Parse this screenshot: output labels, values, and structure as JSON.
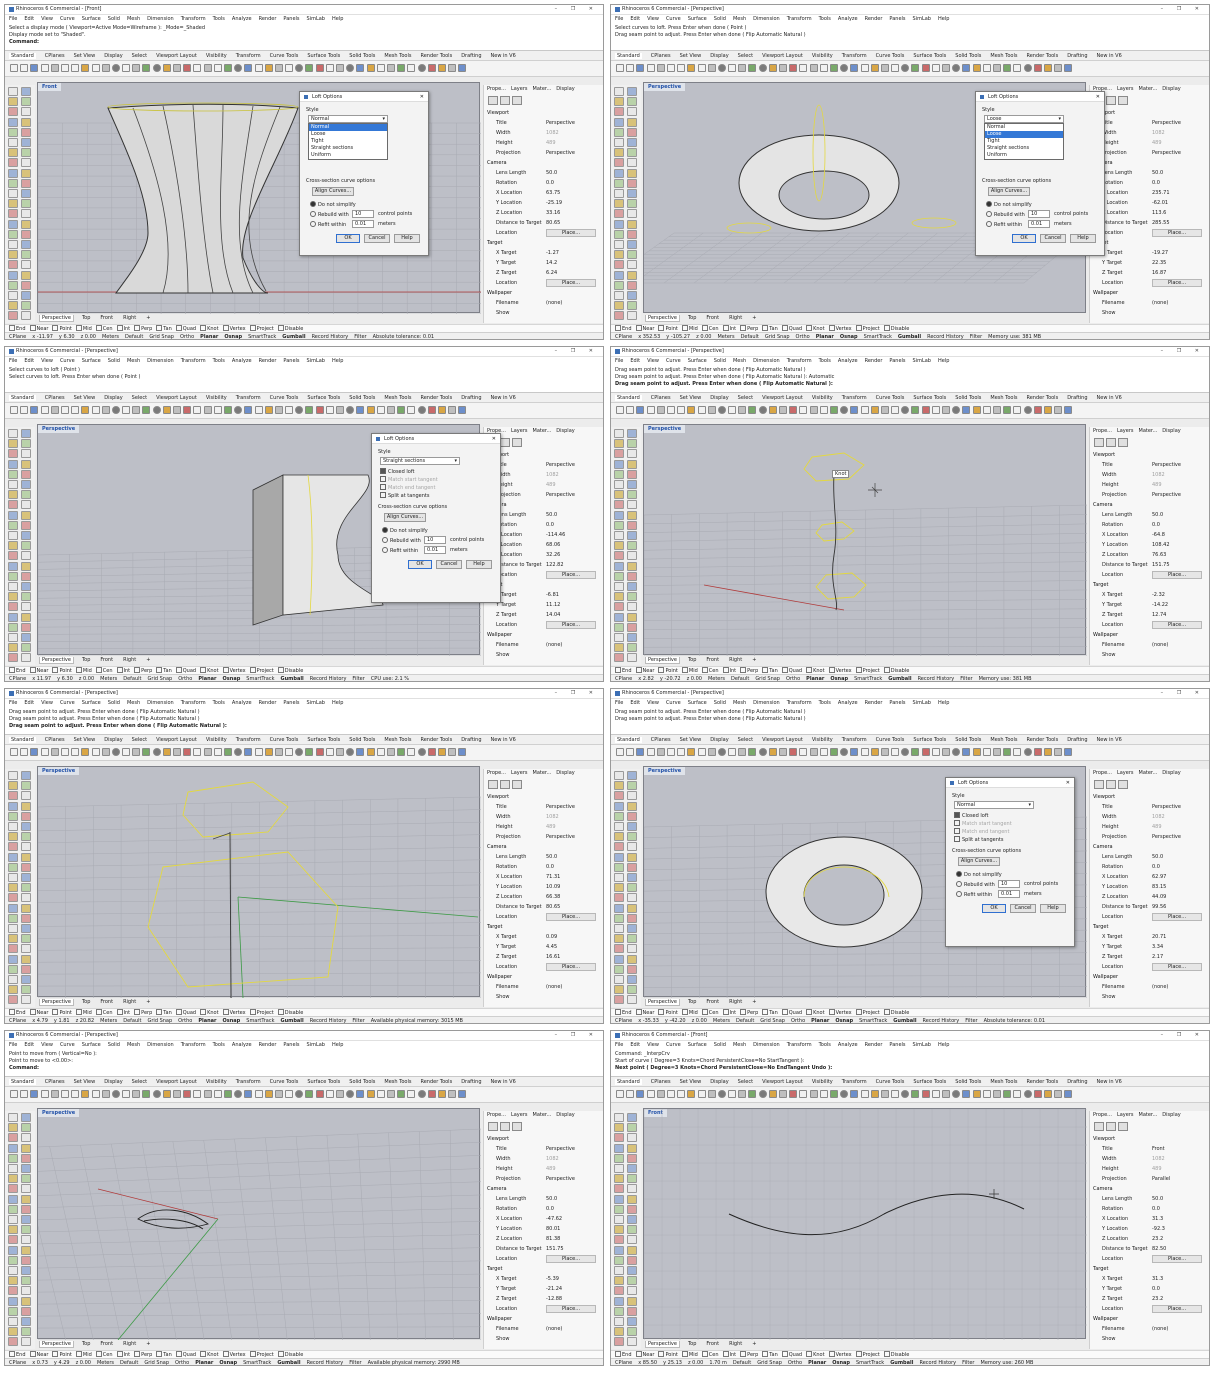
{
  "menus": [
    "File",
    "Edit",
    "View",
    "Curve",
    "Surface",
    "Solid",
    "Mesh",
    "Dimension",
    "Transform",
    "Tools",
    "Analyze",
    "Render",
    "Panels",
    "SimLab",
    "Help"
  ],
  "toolbar_tabs": [
    "Standard",
    "CPlanes",
    "Set View",
    "Display",
    "Select",
    "Viewport Layout",
    "Visibility",
    "Transform",
    "Curve Tools",
    "Surface Tools",
    "Solid Tools",
    "Mesh Tools",
    "Render Tools",
    "Drafting",
    "New in V6"
  ],
  "viewport_tabs": [
    "Perspective",
    "Top",
    "Front",
    "Right"
  ],
  "osnaps": [
    "End",
    "Near",
    "Point",
    "Mid",
    "Cen",
    "Int",
    "Perp",
    "Tan",
    "Quad",
    "Knot",
    "Vertex",
    "Project",
    "Disable"
  ],
  "panel_tabs": [
    "Prope...",
    "Layers",
    "Mater...",
    "Display"
  ],
  "window_controls": "– ❐ ✕",
  "panes": [
    {
      "title": "Rhinoceros 6 Commercial - [Front]",
      "cmd": [
        "Select a display mode ( Viewport=Active Mode=Wireframe ): _Mode=_Shaded",
        "Display mode set to \"Shaded\".",
        "Command:"
      ],
      "viewport": "Front",
      "status": {
        "cplane": "CPlane",
        "x": "x -11.97",
        "y": "y 6.30",
        "z": "z 0.00",
        "units": "Meters",
        "layer": "Default",
        "items": [
          "Grid Snap",
          "Ortho",
          "Planar",
          "Osnap",
          "SmartTrack",
          "Gumball",
          "Record History",
          "Filter"
        ],
        "tail": "Absolute tolerance: 0.01"
      },
      "props": [
        [
          "Title",
          "Perspective"
        ],
        [
          "Width",
          "1082"
        ],
        [
          "Height",
          "489"
        ],
        [
          "Projection",
          "Perspective"
        ],
        [
          "Lens Length",
          "50.0"
        ],
        [
          "Rotation",
          "0.0"
        ],
        [
          "X Location",
          "63.75"
        ],
        [
          "Y Location",
          "-25.19"
        ],
        [
          "Z Location",
          "33.16"
        ],
        [
          "Distance to Target",
          "80.65"
        ],
        [
          "Location",
          "Place..."
        ],
        [
          "X Target",
          "-1.27"
        ],
        [
          "Y Target",
          "14.2"
        ],
        [
          "Z Target",
          "6.24"
        ],
        [
          "Location",
          "Place..."
        ],
        [
          "Filename",
          "(none)"
        ],
        [
          "Show",
          ""
        ]
      ],
      "loft": {
        "title": "Loft Options",
        "style_label": "Style",
        "style_value": "Normal",
        "dropdown": [
          "Normal",
          "Loose",
          "Tight",
          "Straight sections",
          "Uniform"
        ],
        "highlight": 0,
        "cs_label": "Cross-section curve options",
        "align": "Align Curves...",
        "r1": "Do not simplify",
        "r2": "Rebuild with",
        "r2v": "10",
        "r2u": "control points",
        "r3": "Refit within",
        "r3v": "0.01",
        "r3u": "meters",
        "ok": "OK",
        "cancel": "Cancel",
        "help": "Help"
      }
    },
    {
      "title": "Rhinoceros 6 Commercial - [Perspective]",
      "cmd": [
        "Select curves to loft. Press Enter when done ( Point )",
        "Drag seam point to adjust. Press Enter when done ( Flip  Automatic  Natural )",
        ""
      ],
      "viewport": "Perspective",
      "status": {
        "cplane": "CPlane",
        "x": "x 352.53",
        "y": "y -105.27",
        "z": "z 0.00",
        "units": "Meters",
        "layer": "Default",
        "items": [
          "Grid Snap",
          "Ortho",
          "Planar",
          "Osnap",
          "SmartTrack",
          "Gumball",
          "Record History",
          "Filter"
        ],
        "tail": "Memory use: 381 MB"
      },
      "props": [
        [
          "Title",
          "Perspective"
        ],
        [
          "Width",
          "1082"
        ],
        [
          "Height",
          "489"
        ],
        [
          "Projection",
          "Perspective"
        ],
        [
          "Lens Length",
          "50.0"
        ],
        [
          "Rotation",
          "0.0"
        ],
        [
          "X Location",
          "235.71"
        ],
        [
          "Y Location",
          "-62.01"
        ],
        [
          "Z Location",
          "113.6"
        ],
        [
          "Distance to Target",
          "285.55"
        ],
        [
          "Location",
          "Place..."
        ],
        [
          "X Target",
          "-19.27"
        ],
        [
          "Y Target",
          "22.35"
        ],
        [
          "Z Target",
          "16.87"
        ],
        [
          "Location",
          "Place..."
        ],
        [
          "Filename",
          "(none)"
        ],
        [
          "Show",
          ""
        ]
      ],
      "loft": {
        "title": "Loft Options",
        "style_label": "Style",
        "style_value": "Loose",
        "dropdown": [
          "Normal",
          "Loose",
          "Tight",
          "Straight sections",
          "Uniform"
        ],
        "highlight": 1,
        "cs_label": "Cross-section curve options",
        "align": "Align Curves...",
        "r1": "Do not simplify",
        "r2": "Rebuild with",
        "r2v": "10",
        "r2u": "control points",
        "r3": "Refit within",
        "r3v": "0.01",
        "r3u": "meters",
        "ok": "OK",
        "cancel": "Cancel",
        "help": "Help"
      }
    },
    {
      "title": "Rhinoceros 6 Commercial - [Perspective]",
      "cmd": [
        "Select curves to loft ( Point )",
        "Select curves to loft. Press Enter when done ( Point )",
        ""
      ],
      "viewport": "Perspective",
      "status": {
        "cplane": "CPlane",
        "x": "x 11.97",
        "y": "y 6.30",
        "z": "z 0.00",
        "units": "Meters",
        "layer": "Default",
        "items": [
          "Grid Snap",
          "Ortho",
          "Planar",
          "Osnap",
          "SmartTrack",
          "Gumball",
          "Record History",
          "Filter"
        ],
        "tail": "CPU use: 2.1 %"
      },
      "props": [
        [
          "Title",
          "Perspective"
        ],
        [
          "Width",
          "1082"
        ],
        [
          "Height",
          "489"
        ],
        [
          "Projection",
          "Perspective"
        ],
        [
          "Lens Length",
          "50.0"
        ],
        [
          "Rotation",
          "0.0"
        ],
        [
          "X Location",
          "-114.46"
        ],
        [
          "Y Location",
          "68.06"
        ],
        [
          "Z Location",
          "32.26"
        ],
        [
          "Distance to Target",
          "122.82"
        ],
        [
          "Location",
          "Place..."
        ],
        [
          "X Target",
          "-6.81"
        ],
        [
          "Y Target",
          "11.12"
        ],
        [
          "Z Target",
          "14.04"
        ],
        [
          "Location",
          "Place..."
        ],
        [
          "Filename",
          "(none)"
        ],
        [
          "Show",
          ""
        ]
      ],
      "loft2": {
        "title": "Loft Options",
        "style_label": "Style",
        "style_value": "Straight sections",
        "c1": "Closed loft",
        "c2": "Match start tangent",
        "c3": "Match end tangent",
        "c4": "Split at tangents",
        "cs_label": "Cross-section curve options",
        "align": "Align Curves...",
        "r1": "Do not simplify",
        "r2": "Rebuild with",
        "r2v": "10",
        "r2u": "control points",
        "r3": "Refit within",
        "r3v": "0.01",
        "r3u": "meters",
        "ok": "OK",
        "cancel": "Cancel",
        "help": "Help"
      }
    },
    {
      "title": "Rhinoceros 6 Commercial - [Perspective]",
      "cmd": [
        "Drag seam point to adjust. Press Enter when done ( Flip  Automatic  Natural )",
        "Drag seam point to adjust. Press Enter when done ( Flip  Automatic  Natural ): Automatic",
        "Drag seam point to adjust. Press Enter when done ( Flip  Automatic  Natural ):"
      ],
      "viewport": "Perspective",
      "knot_label": "Knot",
      "status": {
        "cplane": "CPlane",
        "x": "x 2.82",
        "y": "y -20.72",
        "z": "z 0.00",
        "units": "Meters",
        "layer": "Default",
        "items": [
          "Grid Snap",
          "Ortho",
          "Planar",
          "Osnap",
          "SmartTrack",
          "Gumball",
          "Record History",
          "Filter"
        ],
        "tail": "Memory use: 381 MB"
      },
      "props": [
        [
          "Title",
          "Perspective"
        ],
        [
          "Width",
          "1082"
        ],
        [
          "Height",
          "489"
        ],
        [
          "Projection",
          "Perspective"
        ],
        [
          "Lens Length",
          "50.0"
        ],
        [
          "Rotation",
          "0.0"
        ],
        [
          "X Location",
          "-64.8"
        ],
        [
          "Y Location",
          "108.42"
        ],
        [
          "Z Location",
          "76.63"
        ],
        [
          "Distance to Target",
          "151.75"
        ],
        [
          "Location",
          "Place..."
        ],
        [
          "X Target",
          "-2.32"
        ],
        [
          "Y Target",
          "-14.22"
        ],
        [
          "Z Target",
          "12.74"
        ],
        [
          "Location",
          "Place..."
        ],
        [
          "Filename",
          "(none)"
        ],
        [
          "Show",
          ""
        ]
      ]
    },
    {
      "title": "Rhinoceros 6 Commercial - [Perspective]",
      "cmd": [
        "Drag seam point to adjust. Press Enter when done ( Flip  Automatic  Natural )",
        "Drag seam point to adjust. Press Enter when done ( Flip  Automatic  Natural )",
        "Drag seam point to adjust. Press Enter when done ( Flip  Automatic  Natural ):"
      ],
      "viewport": "Perspective",
      "status": {
        "cplane": "CPlane",
        "x": "x 4.79",
        "y": "y 1.81",
        "z": "z 20.82",
        "units": "Meters",
        "layer": "Default",
        "items": [
          "Grid Snap",
          "Ortho",
          "Planar",
          "Osnap",
          "SmartTrack",
          "Gumball",
          "Record History",
          "Filter"
        ],
        "tail": "Available physical memory: 3015 MB"
      },
      "props": [
        [
          "Title",
          "Perspective"
        ],
        [
          "Width",
          "1082"
        ],
        [
          "Height",
          "489"
        ],
        [
          "Projection",
          "Perspective"
        ],
        [
          "Lens Length",
          "50.0"
        ],
        [
          "Rotation",
          "0.0"
        ],
        [
          "X Location",
          "71.31"
        ],
        [
          "Y Location",
          "10.09"
        ],
        [
          "Z Location",
          "66.38"
        ],
        [
          "Distance to Target",
          "80.65"
        ],
        [
          "Location",
          "Place..."
        ],
        [
          "X Target",
          "0.09"
        ],
        [
          "Y Target",
          "4.45"
        ],
        [
          "Z Target",
          "16.61"
        ],
        [
          "Location",
          "Place..."
        ],
        [
          "Filename",
          "(none)"
        ],
        [
          "Show",
          ""
        ]
      ]
    },
    {
      "title": "Rhinoceros 6 Commercial - [Perspective]",
      "cmd": [
        "Drag seam point to adjust. Press Enter when done ( Flip  Automatic  Natural )",
        "Drag seam point to adjust. Press Enter when done ( Flip  Automatic  Natural )",
        ""
      ],
      "viewport": "Perspective",
      "status": {
        "cplane": "CPlane",
        "x": "x -35.33",
        "y": "y -42.20",
        "z": "z 0.00",
        "units": "Meters",
        "layer": "Default",
        "items": [
          "Grid Snap",
          "Ortho",
          "Planar",
          "Osnap",
          "SmartTrack",
          "Gumball",
          "Record History",
          "Filter"
        ],
        "tail": "Absolute tolerance: 0.01"
      },
      "props": [
        [
          "Title",
          "Perspective"
        ],
        [
          "Width",
          "1082"
        ],
        [
          "Height",
          "489"
        ],
        [
          "Projection",
          "Perspective"
        ],
        [
          "Lens Length",
          "50.0"
        ],
        [
          "Rotation",
          "0.0"
        ],
        [
          "X Location",
          "62.97"
        ],
        [
          "Y Location",
          "83.15"
        ],
        [
          "Z Location",
          "44.09"
        ],
        [
          "Distance to Target",
          "99.56"
        ],
        [
          "Location",
          "Place..."
        ],
        [
          "X Target",
          "20.71"
        ],
        [
          "Y Target",
          "3.34"
        ],
        [
          "Z Target",
          "2.17"
        ],
        [
          "Location",
          "Place..."
        ],
        [
          "Filename",
          "(none)"
        ],
        [
          "Show",
          ""
        ]
      ],
      "loft2": {
        "title": "Loft Options",
        "style_label": "Style",
        "style_value": "Normal",
        "c1": "Closed loft",
        "c2": "Match start tangent",
        "c3": "Match end tangent",
        "c4": "Split at tangents",
        "cs_label": "Cross-section curve options",
        "align": "Align Curves...",
        "r1": "Do not simplify",
        "r2": "Rebuild with",
        "r2v": "10",
        "r2u": "control points",
        "r3": "Refit within",
        "r3v": "0.01",
        "r3u": "meters",
        "ok": "OK",
        "cancel": "Cancel",
        "help": "Help"
      }
    },
    {
      "title": "Rhinoceros 6 Commercial - [Perspective]",
      "cmd": [
        "Point to move from ( Vertical=No ):",
        "Point to move to <0.00>:",
        "Command:"
      ],
      "viewport": "Perspective",
      "status": {
        "cplane": "CPlane",
        "x": "x 0.73",
        "y": "y 4.29",
        "z": "z 0.00",
        "units": "Meters",
        "layer": "Default",
        "items": [
          "Grid Snap",
          "Ortho",
          "Planar",
          "Osnap",
          "SmartTrack",
          "Gumball",
          "Record History",
          "Filter"
        ],
        "tail": "Available physical memory: 2990 MB"
      },
      "props": [
        [
          "Title",
          "Perspective"
        ],
        [
          "Width",
          "1082"
        ],
        [
          "Height",
          "489"
        ],
        [
          "Projection",
          "Perspective"
        ],
        [
          "Lens Length",
          "50.0"
        ],
        [
          "Rotation",
          "0.0"
        ],
        [
          "X Location",
          "-47.62"
        ],
        [
          "Y Location",
          "80.01"
        ],
        [
          "Z Location",
          "81.38"
        ],
        [
          "Distance to Target",
          "151.75"
        ],
        [
          "Location",
          "Place..."
        ],
        [
          "X Target",
          "-5.39"
        ],
        [
          "Y Target",
          "-21.24"
        ],
        [
          "Z Target",
          "-12.88"
        ],
        [
          "Location",
          "Place..."
        ],
        [
          "Filename",
          "(none)"
        ],
        [
          "Show",
          ""
        ]
      ]
    },
    {
      "title": "Rhinoceros 6 Commercial - [Front]",
      "cmd": [
        "Command: _InterpCrv",
        "Start of curve ( Degree=3  Knots=Chord  PersistentClose=No  StartTangent ):",
        "Next point ( Degree=3  Knots=Chord  PersistentClose=No  EndTangent  Undo ):"
      ],
      "viewport": "Front",
      "status": {
        "cplane": "CPlane",
        "x": "x 85.50",
        "y": "y 25.13",
        "z": "z 0.00",
        "units": "1.70 m",
        "layer": "Default",
        "items": [
          "Grid Snap",
          "Ortho",
          "Planar",
          "Osnap",
          "SmartTrack",
          "Gumball",
          "Record History",
          "Filter"
        ],
        "tail": "Memory use: 260 MB"
      },
      "props": [
        [
          "Title",
          "Front"
        ],
        [
          "Width",
          "1082"
        ],
        [
          "Height",
          "489"
        ],
        [
          "Projection",
          "Parallel"
        ],
        [
          "Lens Length",
          "50.0"
        ],
        [
          "Rotation",
          "0.0"
        ],
        [
          "X Location",
          "31.3"
        ],
        [
          "Y Location",
          "-92.3"
        ],
        [
          "Z Location",
          "23.2"
        ],
        [
          "Distance to Target",
          "82.50"
        ],
        [
          "Location",
          "Place..."
        ],
        [
          "X Target",
          "31.3"
        ],
        [
          "Y Target",
          "0.0"
        ],
        [
          "Z Target",
          "23.2"
        ],
        [
          "Location",
          "Place..."
        ],
        [
          "Filename",
          "(none)"
        ],
        [
          "Show",
          ""
        ]
      ]
    }
  ]
}
